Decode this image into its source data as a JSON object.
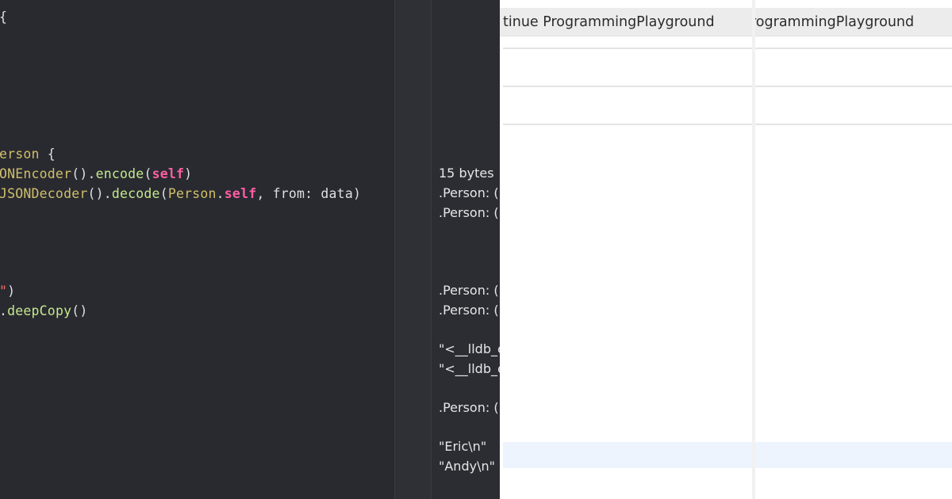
{
  "editor": {
    "lines": {
      "l1": "{",
      "l2_type": "erson",
      "l2_rest": " {",
      "l3_type": "ONEncoder",
      "l3_mid": "().",
      "l3_func": "encode",
      "l3_open": "(",
      "l3_kw": "self",
      "l3_close": ")",
      "l4_type": "JSONDecoder",
      "l4_mid": "().",
      "l4_func": "decode",
      "l4_open": "(",
      "l4_type2": "Person",
      "l4_dot": ".",
      "l4_kw": "self",
      "l4_rest": ", from: data)",
      "l5_str": "\"",
      "l5_rest": ")",
      "l6_dot": ".",
      "l6_func": "deepCopy",
      "l6_rest": "()"
    }
  },
  "results": {
    "r1": "15 bytes",
    "r2": ".Person: (",
    "r3": ".Person: (",
    "r4": ".Person: (",
    "r5": ".Person: (",
    "r6": "\"<__lldb_e",
    "r7": "\"<__lldb_e",
    "r8": ".Person: (",
    "r9": "\"Eric\\n\"",
    "r10": "\"Andy\\n\""
  },
  "inspector": {
    "panel1_title": "tinue ProgrammingPlayground",
    "panel2_title": "rogrammingPlayground"
  },
  "colors": {
    "editor_bg": "#292a30",
    "type": "#d0bf69",
    "keyword": "#fc5fa3",
    "string": "#fc6a5d",
    "highlight_row": "#edf4fd"
  }
}
